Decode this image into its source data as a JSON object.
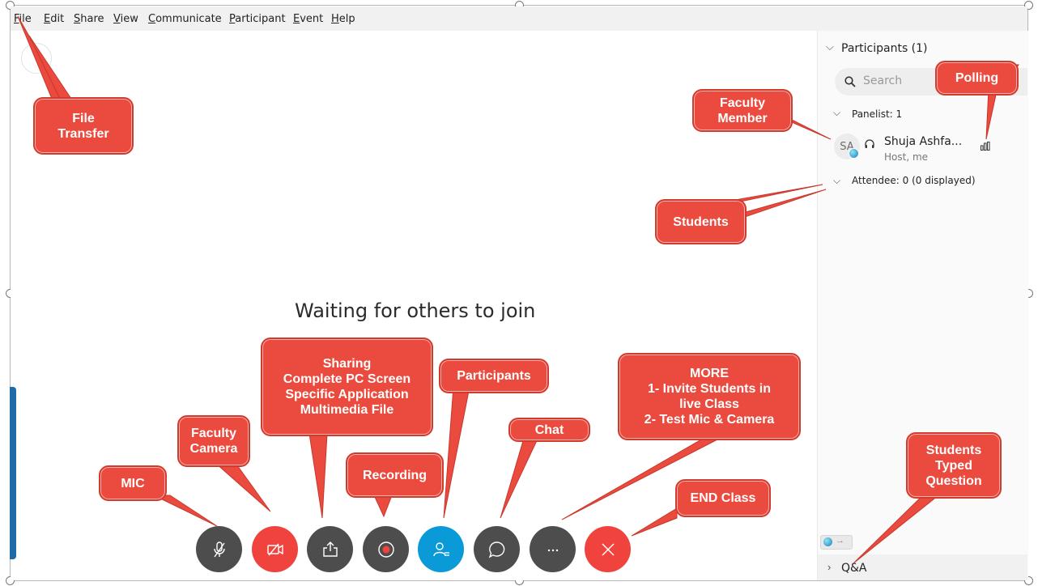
{
  "menu": [
    "File",
    "Edit",
    "Share",
    "View",
    "Communicate",
    "Participant",
    "Event",
    "Help"
  ],
  "stage": {
    "waiting_text": "Waiting for others to join"
  },
  "panel": {
    "participants_header": "Participants (1)",
    "search_placeholder": "Search",
    "panelist_header": "Panelist: 1",
    "participant": {
      "initials": "SA",
      "name": "Shuja Ashfa...",
      "role": "Host, me"
    },
    "attendee_header": "Attendee: 0 (0 displayed)",
    "qa_label": "Q&A"
  },
  "controls": [
    {
      "name": "mic-button",
      "icon": "mic-muted-icon",
      "color": "#4d4d4d"
    },
    {
      "name": "camera-button",
      "icon": "video-off-icon",
      "color": "#f0433e"
    },
    {
      "name": "share-button",
      "icon": "share-upload-icon",
      "color": "#4d4d4d"
    },
    {
      "name": "record-button",
      "icon": "record-icon",
      "color": "#4d4d4d"
    },
    {
      "name": "participants-button",
      "icon": "participants-icon",
      "color": "#0a9ad7"
    },
    {
      "name": "chat-button",
      "icon": "chat-bubble-icon",
      "color": "#4d4d4d"
    },
    {
      "name": "more-button",
      "icon": "ellipsis-icon",
      "color": "#4d4d4d"
    },
    {
      "name": "end-button",
      "icon": "close-icon",
      "color": "#f0433e"
    }
  ],
  "callouts": {
    "file_transfer": [
      "File",
      "Transfer"
    ],
    "polling": [
      "Polling"
    ],
    "faculty_member": [
      "Faculty",
      "Member"
    ],
    "students": [
      "Students"
    ],
    "sharing": [
      "Sharing",
      "Complete PC Screen",
      "Specific Application",
      "Multimedia File"
    ],
    "participants": [
      "Participants"
    ],
    "more": [
      "MORE",
      "1- Invite Students in",
      "live Class",
      "2- Test Mic & Camera"
    ],
    "chat": [
      "Chat"
    ],
    "faculty_camera": [
      "Faculty",
      "Camera"
    ],
    "recording": [
      "Recording"
    ],
    "mic": [
      "MIC"
    ],
    "end_class": [
      "END Class"
    ],
    "students_question": [
      "Students",
      "Typed",
      "Question"
    ]
  },
  "colors": {
    "callout": "#ea4b3e",
    "accent_blue": "#0a9ad7",
    "end_red": "#f0433e"
  }
}
